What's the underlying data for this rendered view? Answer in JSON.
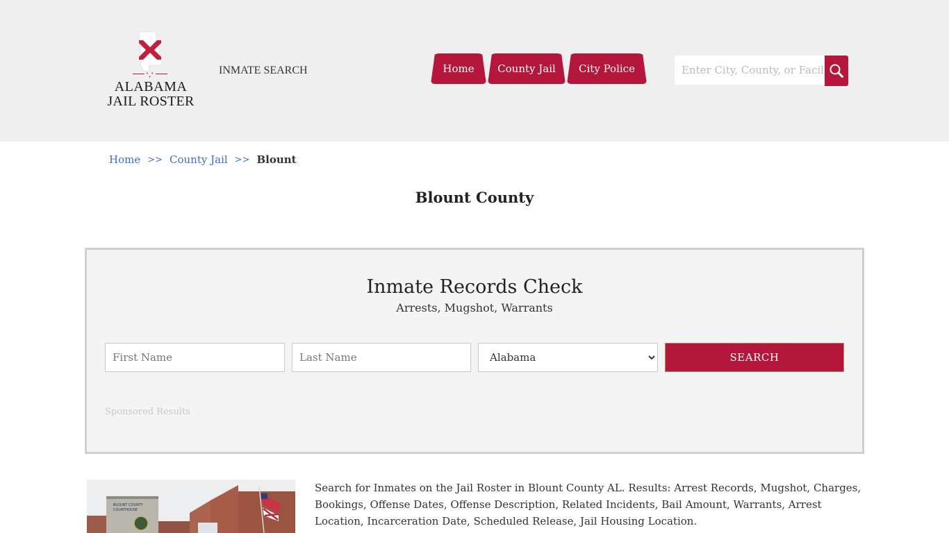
{
  "header": {
    "logo": {
      "line1": "ALABAMA",
      "line2": "JAIL ROSTER",
      "icon": "alabama-state-flag-icon",
      "dots": "• • •"
    },
    "inmate_search_link": "INMATE SEARCH",
    "nav": [
      {
        "label": "Home"
      },
      {
        "label": "County Jail"
      },
      {
        "label": "City Police"
      }
    ],
    "search": {
      "placeholder": "Enter City, County, or Facility",
      "value": "",
      "icon": "search-icon"
    }
  },
  "breadcrumb": {
    "items": [
      {
        "label": "Home"
      },
      {
        "label": "County Jail"
      },
      {
        "label": "Blount"
      }
    ],
    "separator": ">>"
  },
  "page": {
    "title": "Blount County"
  },
  "records_check": {
    "title": "Inmate Records Check",
    "subtitle": "Arrests, Mugshot, Warrants",
    "first_name_placeholder": "First Name",
    "last_name_placeholder": "Last Name",
    "state_selected": "Alabama",
    "search_label": "SEARCH",
    "sponsored_label": "Sponsored Results"
  },
  "content": {
    "image_alt": "Blount County Courthouse",
    "description": "Search for Inmates on the Jail Roster in Blount County AL. Results: Arrest Records, Mugshot, Charges, Bookings, Offense Dates, Offense Description, Related Incidents, Bail Amount, Warrants, Arrest Location, Incarceration Date, Scheduled Release, Jail Housing Location."
  },
  "colors": {
    "accent": "#b5163b",
    "header_bg": "#efefef",
    "link": "#3d6ccf",
    "box_bg": "#f4f4f4"
  }
}
